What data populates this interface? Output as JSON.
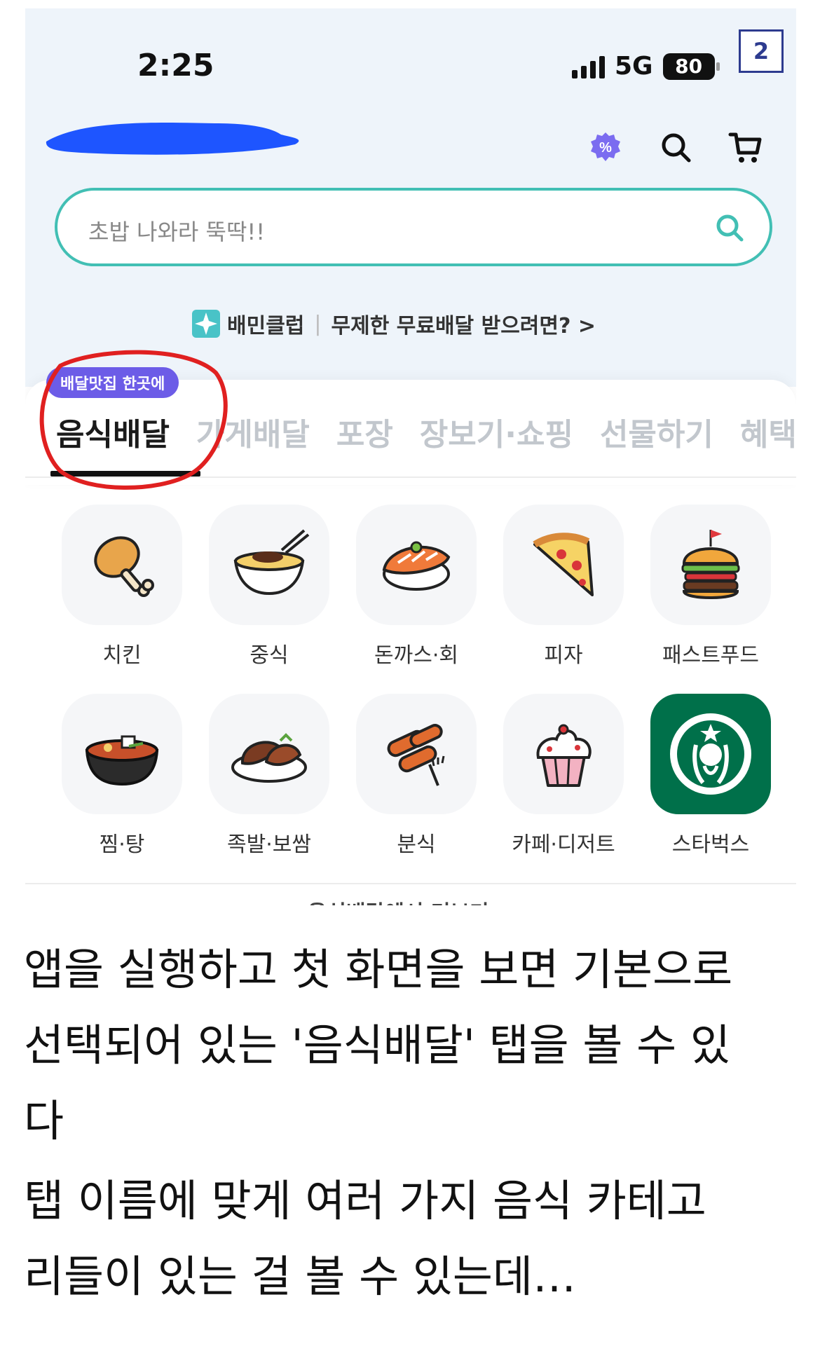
{
  "status_bar": {
    "time": "2:25",
    "network": "5G",
    "battery": "80",
    "page_badge": "2"
  },
  "header": {
    "icons": [
      "coupon-icon",
      "search-icon",
      "cart-icon"
    ]
  },
  "search": {
    "placeholder": "초밥 나와라 뚝딱!!"
  },
  "promo": {
    "brand": "배민클럽",
    "text": "무제한 무료배달 받으려면? >"
  },
  "tabs": {
    "badge": "배달맛집 한곳에",
    "items": [
      "음식배달",
      "가게배달",
      "포장",
      "장보기·쇼핑",
      "선물하기",
      "혜택"
    ],
    "active_index": 0
  },
  "categories": [
    {
      "label": "치킨",
      "icon": "chicken-icon"
    },
    {
      "label": "중식",
      "icon": "noodles-icon"
    },
    {
      "label": "돈까스·회",
      "icon": "sushi-icon"
    },
    {
      "label": "피자",
      "icon": "pizza-icon"
    },
    {
      "label": "패스트푸드",
      "icon": "burger-icon"
    },
    {
      "label": "찜·탕",
      "icon": "stew-icon"
    },
    {
      "label": "족발·보쌈",
      "icon": "jokbal-icon"
    },
    {
      "label": "분식",
      "icon": "tteokbokki-icon"
    },
    {
      "label": "카페·디저트",
      "icon": "cupcake-icon"
    },
    {
      "label": "스타벅스",
      "icon": "starbucks-logo-icon"
    }
  ],
  "more_link": "음식배달에서 더보기 >",
  "caption": {
    "p1_l1": "앱을 실행하고 첫 화면을 보면 기본으로",
    "p1_l2": "선택되어 있는 '음식배달' 탭을 볼 수 있",
    "p1_l3": "다",
    "p2_l1": "탭 이름에 맞게 여러 가지 음식 카테고",
    "p2_l2": "리들이 있는 걸 볼 수 있는데…"
  },
  "colors": {
    "accent_teal": "#42bfb4",
    "badge_purple": "#6c5ce7",
    "annotation_red": "#e02020",
    "starbucks_green": "#00704a"
  }
}
